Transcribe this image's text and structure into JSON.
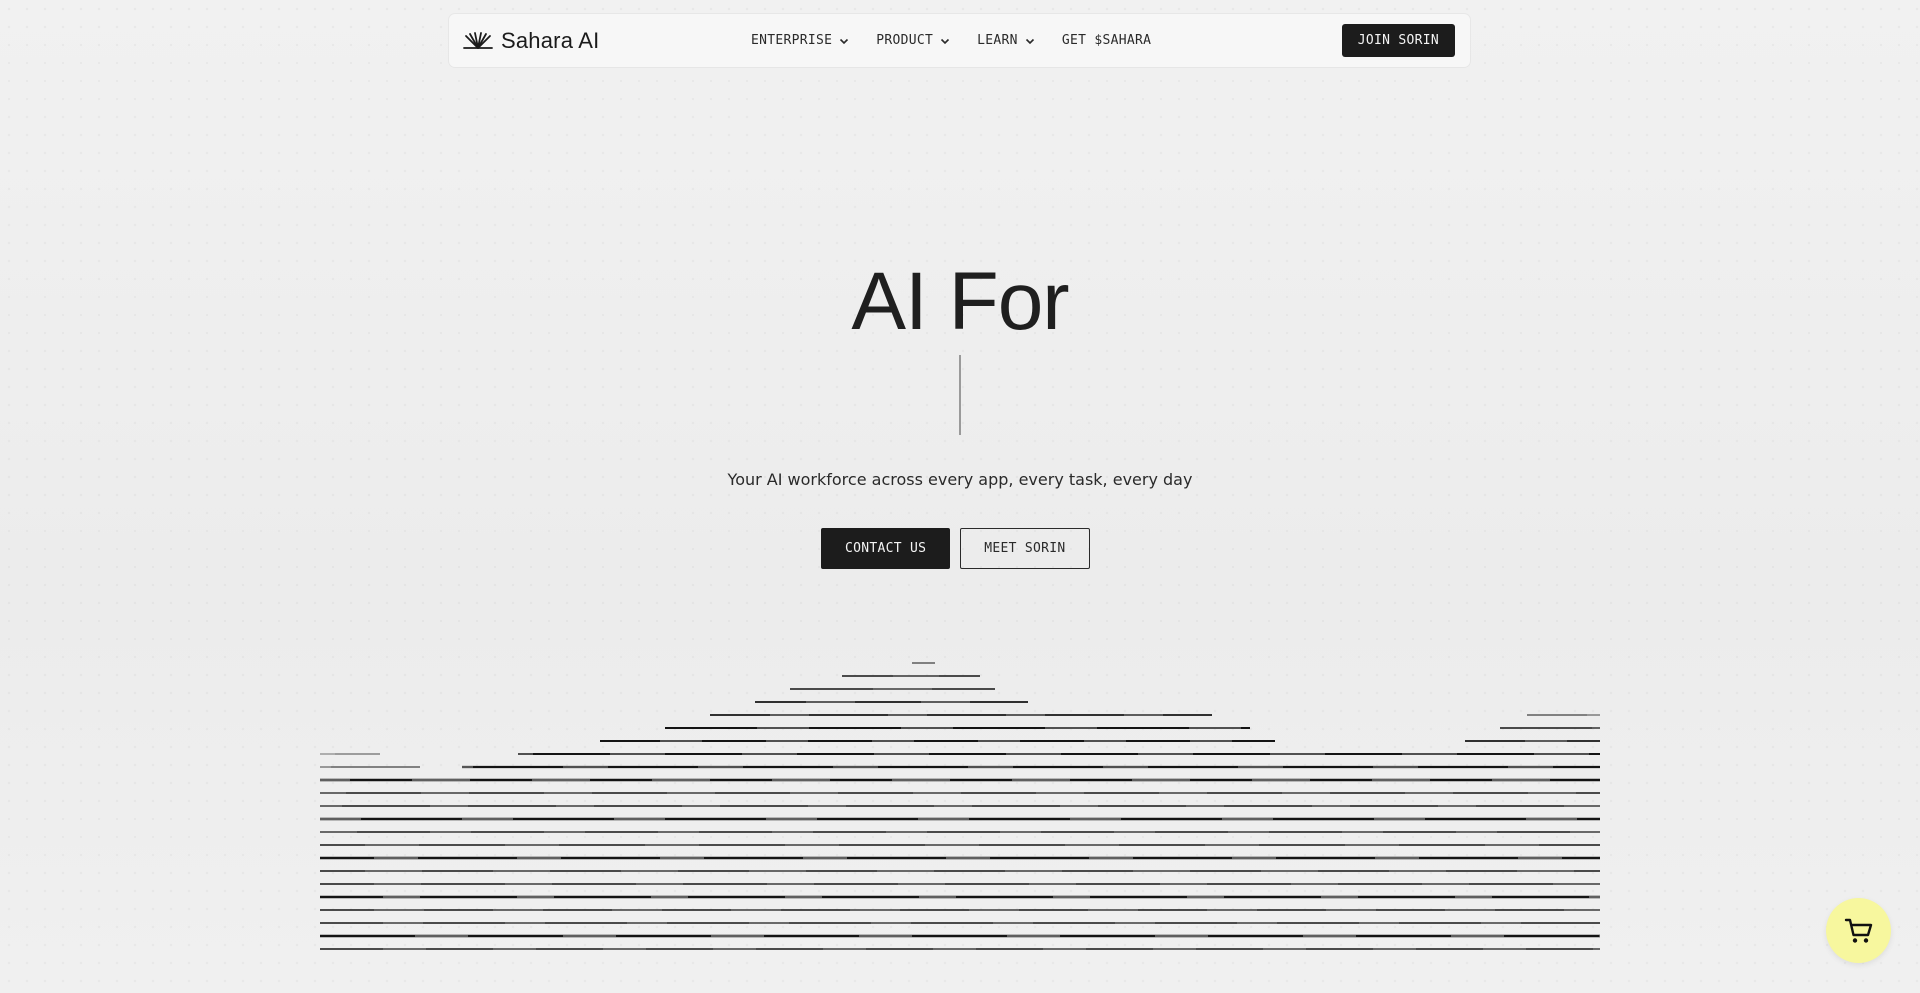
{
  "brand": {
    "name": "Sahara AI",
    "logo_icon": "sahara-fan-icon"
  },
  "nav": {
    "items": [
      {
        "label": "ENTERPRISE",
        "has_dropdown": true
      },
      {
        "label": "PRODUCT",
        "has_dropdown": true
      },
      {
        "label": "LEARN",
        "has_dropdown": true
      },
      {
        "label": "GET $SAHARA",
        "has_dropdown": false
      }
    ],
    "join_label": "JOIN SORIN"
  },
  "hero": {
    "title": "AI For",
    "subtitle": "Your AI workforce across every app, every task, every day",
    "contact_label": "CONTACT US",
    "meet_label": "MEET SORIN"
  },
  "cart": {
    "icon": "cart-icon"
  },
  "colors": {
    "background": "#efefef",
    "dark": "#1c1c1c",
    "cart_bg": "#f7f79e"
  }
}
